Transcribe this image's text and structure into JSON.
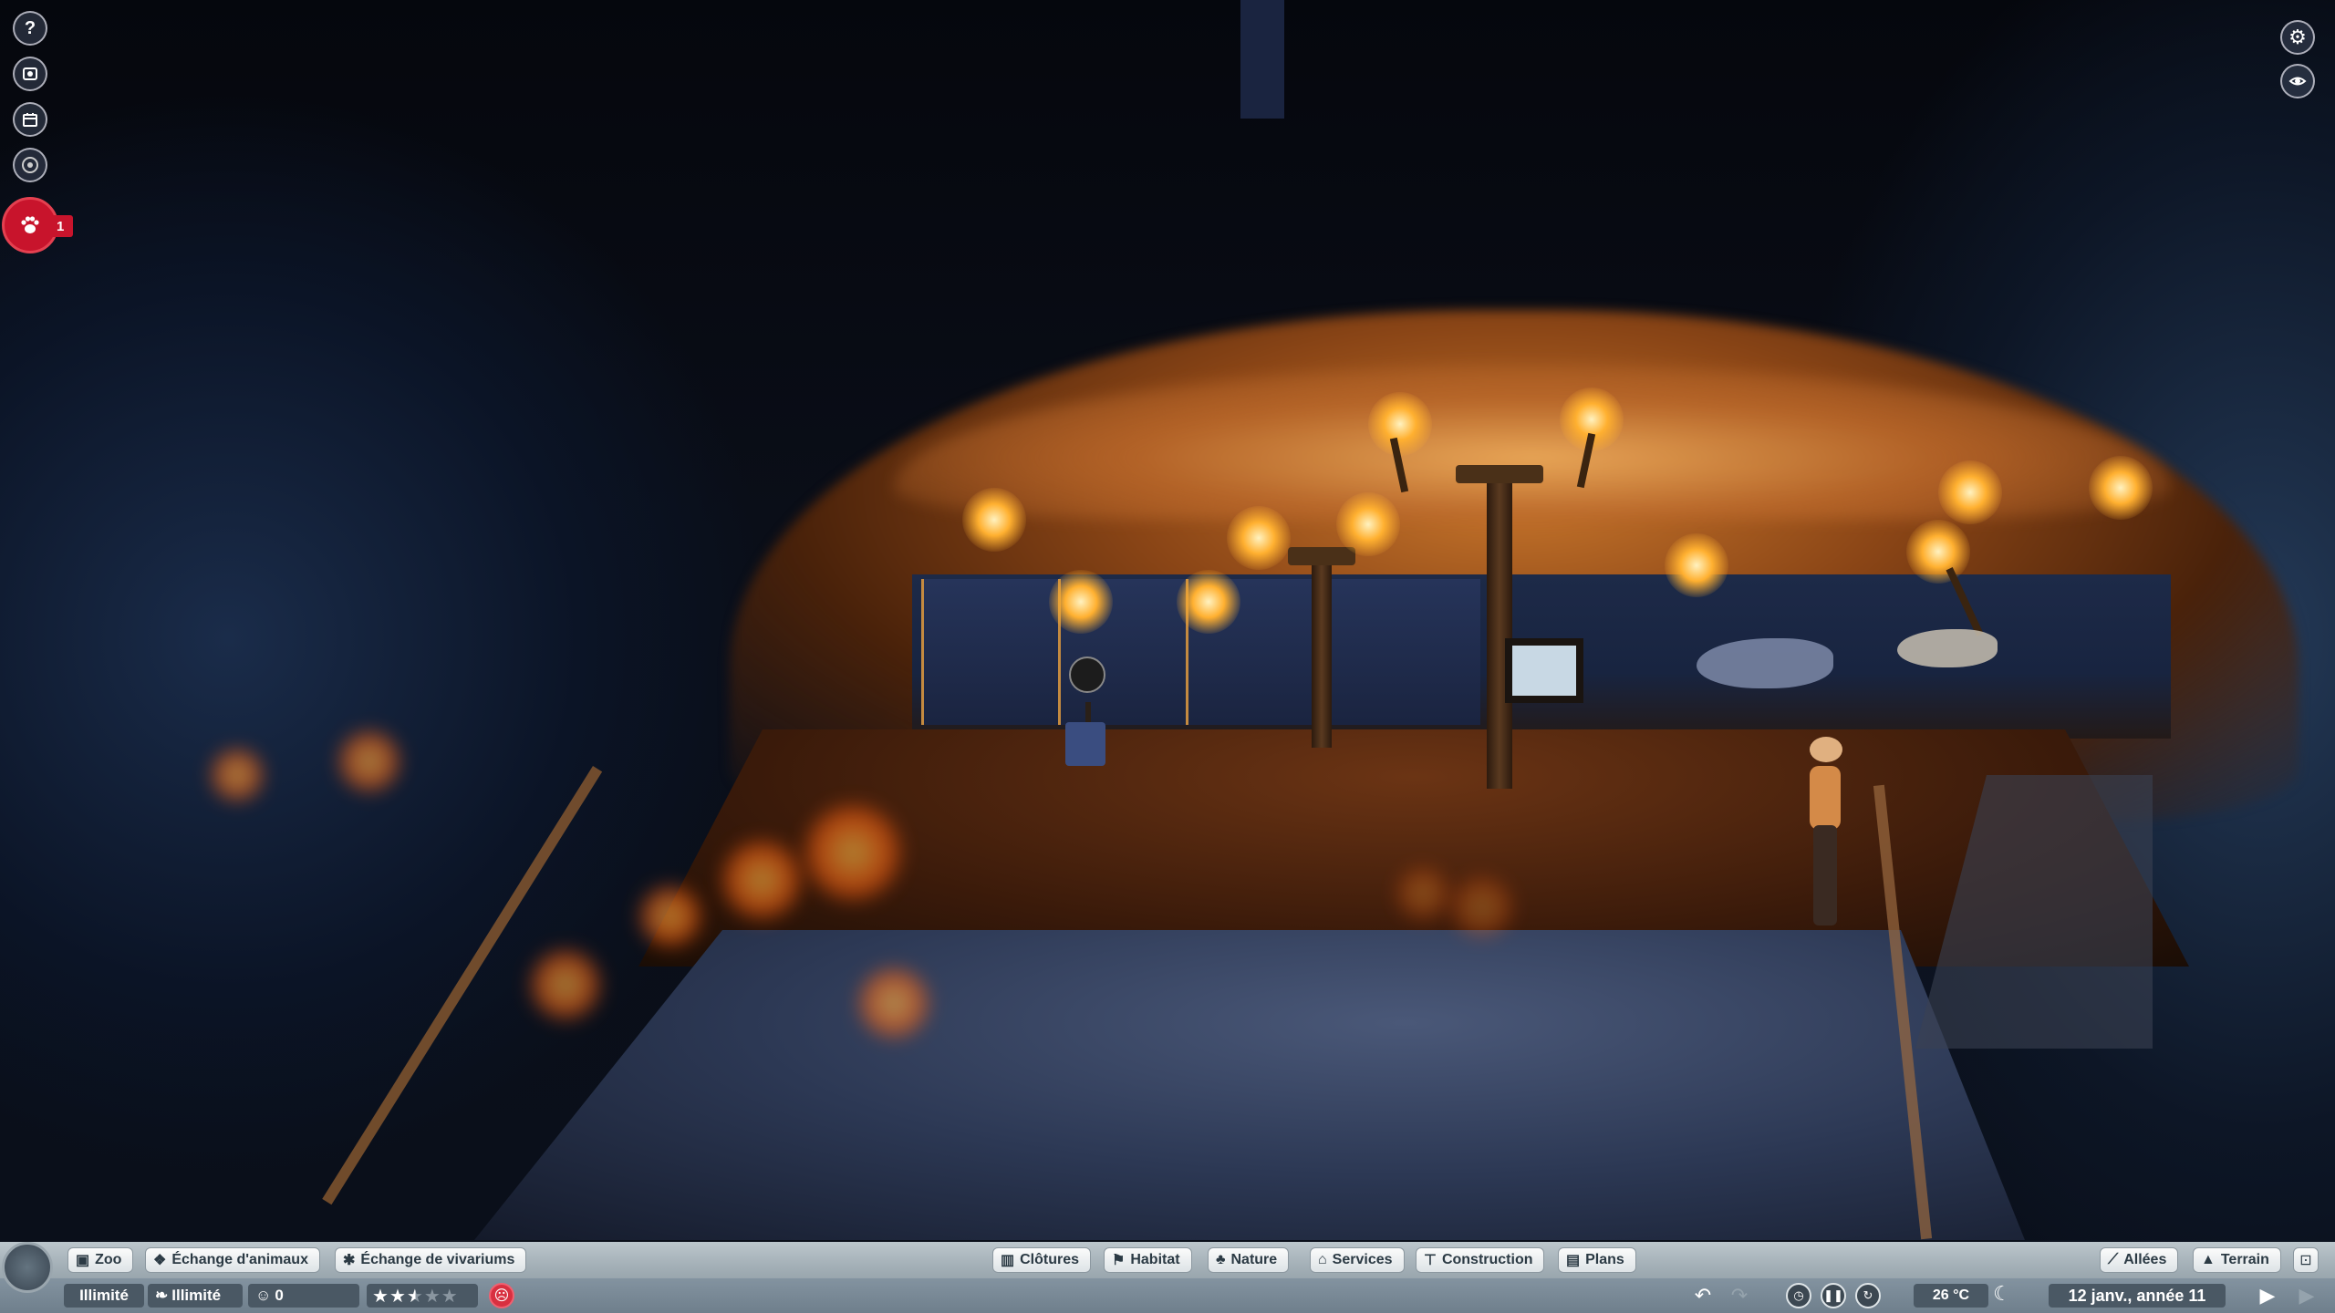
{
  "left_toolbar": {
    "help_icon": "?",
    "zoo_icon": "zoo-icon",
    "calendar_icon": "calendar-icon",
    "view_icon": "eye-icon",
    "animals_icon": "paw-icon",
    "animals_badge": "1"
  },
  "right_toolbar": {
    "settings_icon": "gear-icon",
    "camera_icon": "camera-icon"
  },
  "bottom_bar": {
    "left_tabs": [
      {
        "label": "Zoo",
        "icon": "zoo-icon"
      },
      {
        "label": "Échange d'animaux",
        "icon": "paw-icon"
      },
      {
        "label": "Échange de vivariums",
        "icon": "bug-icon"
      }
    ],
    "center_tabs": [
      {
        "label": "Clôtures",
        "icon": "fence-icon"
      },
      {
        "label": "Habitat",
        "icon": "habitat-icon"
      },
      {
        "label": "Nature",
        "icon": "tree-icon"
      },
      {
        "label": "Services",
        "icon": "building-icon"
      },
      {
        "label": "Construction",
        "icon": "construction-icon"
      },
      {
        "label": "Plans",
        "icon": "blueprint-icon"
      }
    ],
    "right_tabs": [
      {
        "label": "Allées",
        "icon": "path-icon"
      },
      {
        "label": "Terrain",
        "icon": "terrain-icon"
      }
    ],
    "stats": {
      "money": "Illimité",
      "research": "Illimité",
      "guests": "0",
      "rating_stars": 2.5,
      "rating_max": 5
    },
    "controls": {
      "undo_icon": "undo-icon",
      "redo_icon": "redo-icon",
      "temperature": "26 °C",
      "time_of_day_icon": "moon-icon",
      "date": "12 janv., année 11",
      "play_icon": "play-icon",
      "fast_forward_icon": "fast-forward-icon"
    }
  },
  "colors": {
    "alert_red": "#c8142c",
    "bar_light": "#dde3e6",
    "bar_dark": "#4a5864"
  }
}
